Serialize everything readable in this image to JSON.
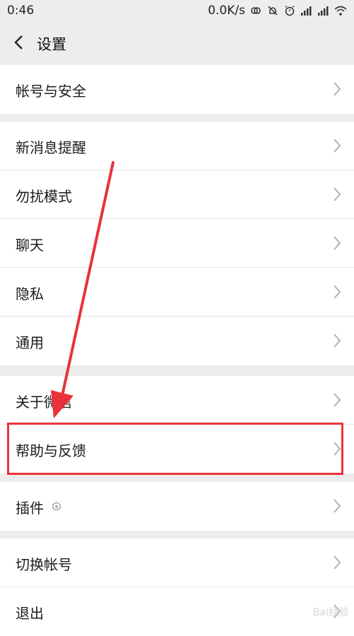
{
  "status_bar": {
    "time": "0:46",
    "network_speed": "0.0K/s"
  },
  "nav": {
    "title": "设置"
  },
  "groups": [
    {
      "items": [
        {
          "label": "帐号与安全"
        }
      ]
    },
    {
      "items": [
        {
          "label": "新消息提醒"
        },
        {
          "label": "勿扰模式"
        },
        {
          "label": "聊天"
        },
        {
          "label": "隐私"
        },
        {
          "label": "通用"
        }
      ]
    },
    {
      "items": [
        {
          "label": "关于微信"
        },
        {
          "label": "帮助与反馈"
        }
      ]
    },
    {
      "items": [
        {
          "label": "插件"
        }
      ]
    },
    {
      "items": [
        {
          "label": "切换帐号"
        },
        {
          "label": "退出"
        }
      ]
    }
  ],
  "watermark": "Bai经验",
  "colors": {
    "background": "#ededed",
    "highlight": "#e8333b",
    "arrow": "#e8333b"
  }
}
